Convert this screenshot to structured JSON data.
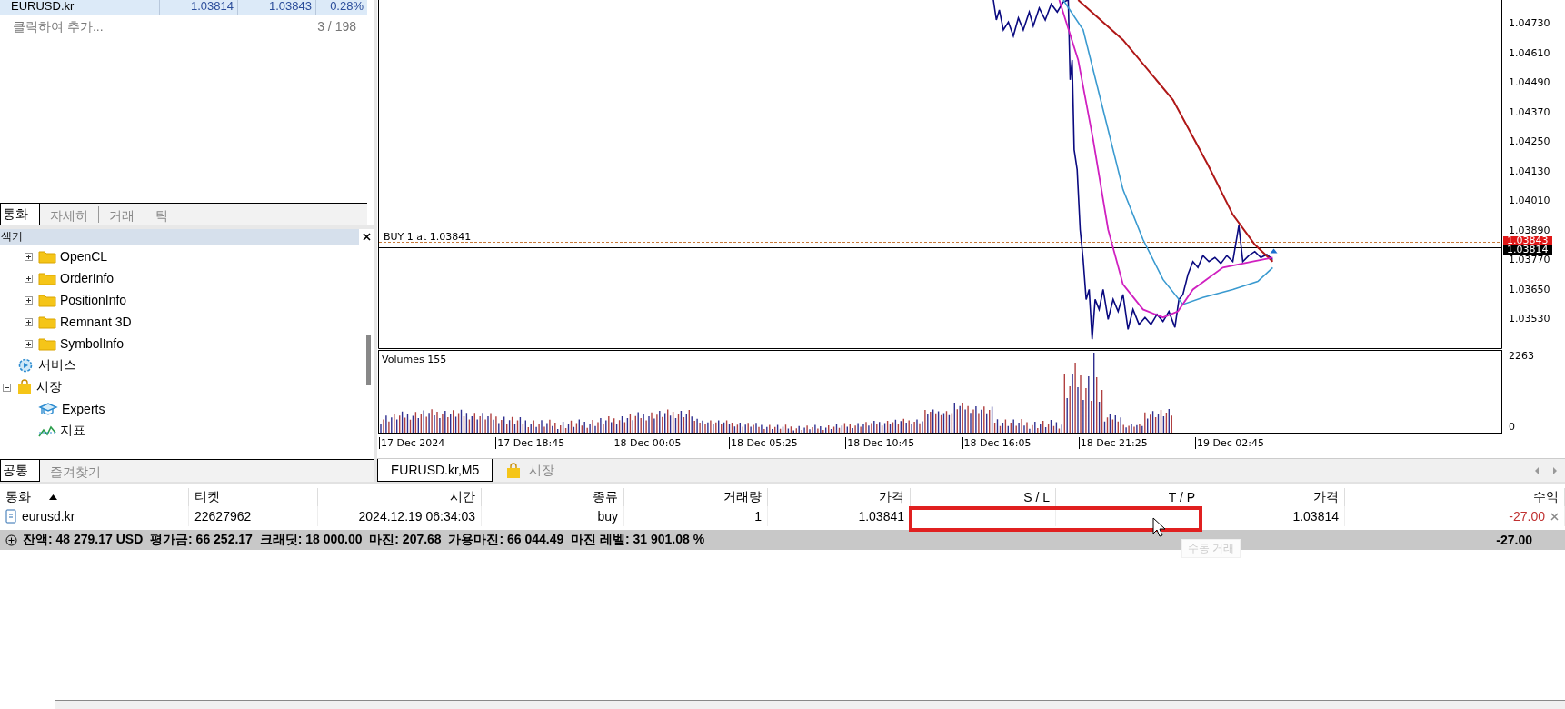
{
  "market_watch": {
    "rows": [
      {
        "symbol": "EURUSD.kr",
        "bid": "1.03814",
        "ask": "1.03843",
        "change": "0.28%",
        "selected": true
      }
    ],
    "add_hint": "클릭하여 추가...",
    "count": "3 / 198",
    "tabs": [
      {
        "label": "통화",
        "selected": true
      },
      {
        "label": "자세히",
        "selected": false
      },
      {
        "label": "거래",
        "selected": false
      },
      {
        "label": "틱",
        "selected": false
      }
    ]
  },
  "navigator": {
    "title": "색기",
    "items": [
      {
        "kind": "continued",
        "children": [
          {
            "kind": "folder",
            "label": "OpenCL",
            "expanded": false
          },
          {
            "kind": "folder",
            "label": "OrderInfo",
            "expanded": false
          },
          {
            "kind": "folder",
            "label": "PositionInfo",
            "expanded": false
          },
          {
            "kind": "folder",
            "label": "Remnant 3D",
            "expanded": false
          },
          {
            "kind": "folder",
            "label": "SymbolInfo",
            "expanded": false
          }
        ]
      },
      {
        "kind": "service",
        "label": "서비스"
      },
      {
        "kind": "market",
        "label": "시장",
        "expanded": true,
        "children": [
          {
            "kind": "experts",
            "label": "Experts"
          },
          {
            "kind": "indicator",
            "label": "지표"
          }
        ]
      }
    ],
    "tabs": [
      {
        "label": "공통",
        "selected": true
      },
      {
        "label": "즐겨찾기",
        "selected": false
      }
    ]
  },
  "chart": {
    "price_labels": [
      "1.04730",
      "1.04610",
      "1.04490",
      "1.04370",
      "1.04250",
      "1.04130",
      "1.04010",
      "1.03890",
      "1.03770",
      "1.03650",
      "1.03530"
    ],
    "ask_tag": "1.03843",
    "bid_tag": "1.03814",
    "order_line": "BUY 1 at 1.03841",
    "volume_label": "Volumes 155",
    "volume_labels": [
      "2263",
      "0"
    ],
    "time_labels": [
      "17 Dec 2024",
      "17 Dec 18:45",
      "18 Dec 00:05",
      "18 Dec 05:25",
      "18 Dec 10:45",
      "18 Dec 16:05",
      "18 Dec 21:25",
      "19 Dec 02:45"
    ],
    "tabs": [
      {
        "kind": "chart",
        "label": "EURUSD.kr,M5",
        "selected": true
      },
      {
        "kind": "market",
        "label": "시장",
        "selected": false
      }
    ]
  },
  "toolbox": {
    "columns": [
      {
        "label": "통화",
        "sorted": true
      },
      {
        "label": "티켓",
        "sorted": false
      },
      {
        "label": "시간",
        "sorted": false
      },
      {
        "label": "종류",
        "sorted": false
      },
      {
        "label": "거래량",
        "sorted": false
      },
      {
        "label": "가격",
        "sorted": false
      },
      {
        "label": "S / L",
        "sorted": false
      },
      {
        "label": "T / P",
        "sorted": false
      },
      {
        "label": "가격",
        "sorted": false
      },
      {
        "label": "수익",
        "sorted": false
      }
    ],
    "rows": [
      {
        "cells": [
          "eurusd.kr",
          "22627962",
          "2024.12.19 06:34:03",
          "buy",
          "1",
          "1.03841",
          "",
          "",
          "1.03814",
          "-27.00"
        ],
        "sl_tp_highlighted": true
      }
    ],
    "summary": "잔액: 48 279.17 USD  평가금: 66 252.17  크래딧: 18 000.00  마진: 207.68  가용마진: 66 044.49  마진 레벨: 31 901.08 %",
    "summary_total": "-27.00",
    "tooltip": "수동 거래"
  }
}
